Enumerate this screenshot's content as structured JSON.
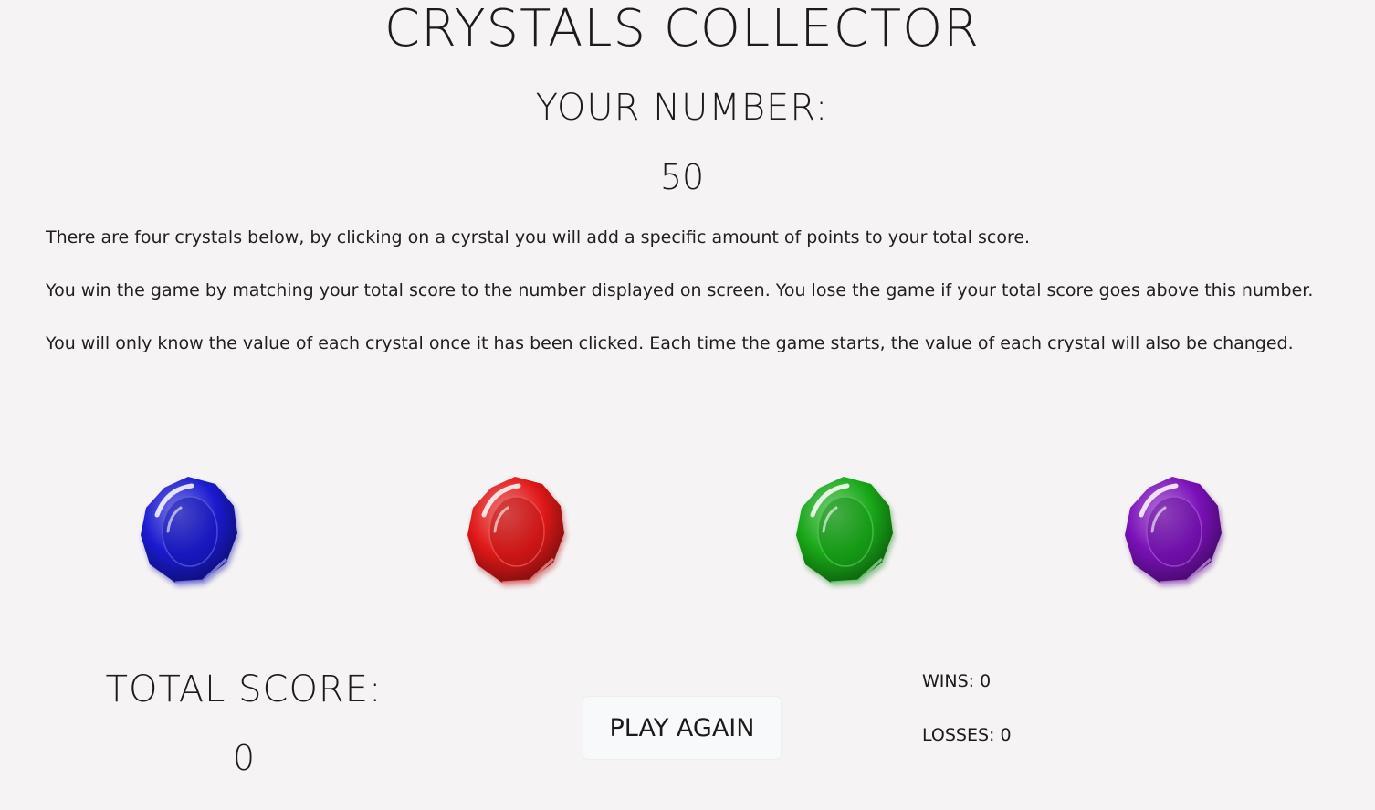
{
  "header": {
    "title": "CRYSTALS COLLECTOR",
    "target_label": "YOUR NUMBER:",
    "target_value": "50"
  },
  "instructions": [
    "There are four crystals below, by clicking on a cyrstal you will add a specific amount of points to your total score.",
    "You win the game by matching your total score to the number displayed on screen. You lose the game if your total score goes above this number.",
    "You will only know the value of each crystal once it has been clicked. Each time the game starts, the value of each crystal will also be changed."
  ],
  "crystals": [
    {
      "icon": "blue-crystal-icon",
      "color": "#1a1ad0"
    },
    {
      "icon": "red-crystal-icon",
      "color": "#e01818"
    },
    {
      "icon": "green-crystal-icon",
      "color": "#18a818"
    },
    {
      "icon": "purple-crystal-icon",
      "color": "#7a10b8"
    }
  ],
  "score": {
    "total_label": "TOTAL SCORE:",
    "total_value": "0"
  },
  "controls": {
    "play_again_label": "PLAY AGAIN"
  },
  "stats": {
    "wins": "WINS: 0",
    "losses": "LOSSES: 0"
  }
}
